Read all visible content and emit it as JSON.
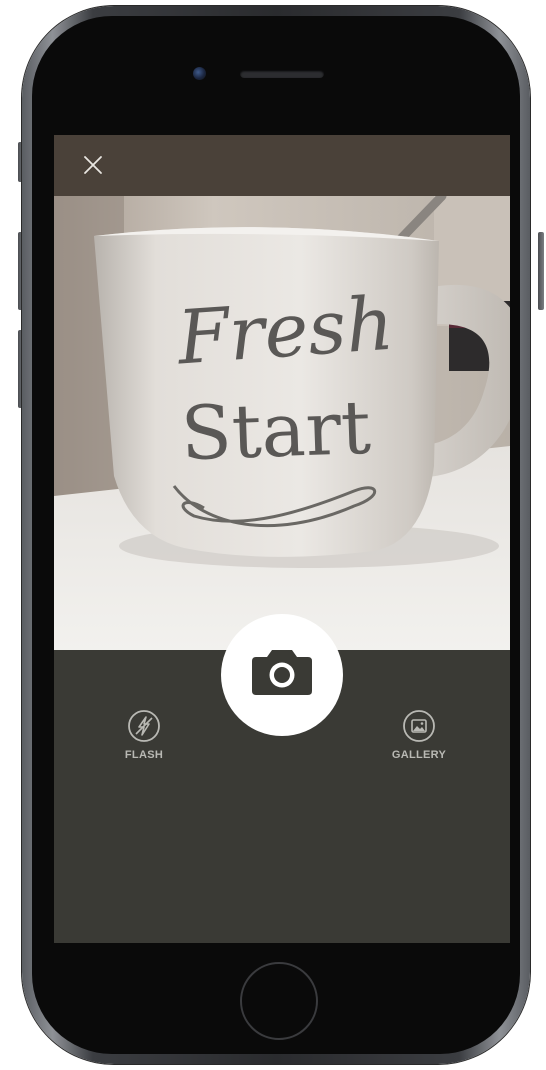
{
  "device": {
    "model": "iPhone",
    "color": "space-gray"
  },
  "camera_screen": {
    "close_icon": "close-icon",
    "viewfinder_subject": "coffee mug",
    "mug_text": [
      "Fresh",
      "Start"
    ],
    "shutter_icon": "camera-icon",
    "controls": {
      "flash": {
        "label": "FLASH",
        "icon": "flash-off-icon"
      },
      "gallery": {
        "label": "GALLERY",
        "icon": "gallery-icon"
      }
    }
  },
  "colors": {
    "top_bar": "#4a4139",
    "bottom_panel": "#3a3a35",
    "shutter": "#ffffff",
    "control_text": "#b9b9b4"
  }
}
